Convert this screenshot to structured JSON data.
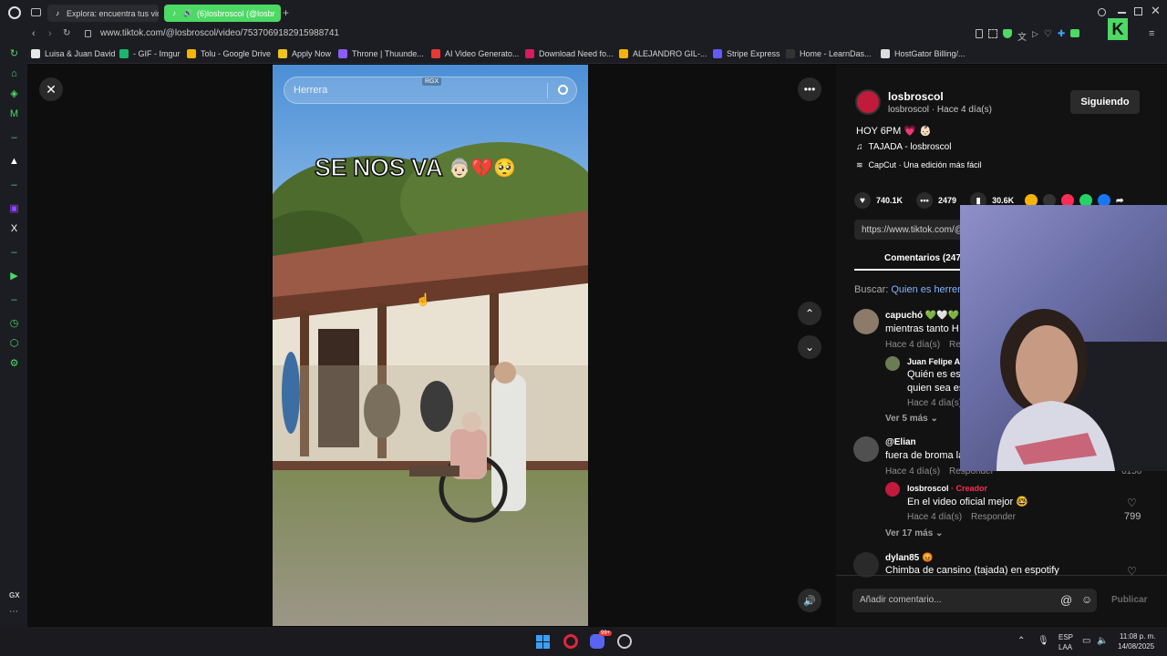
{
  "tabs": [
    {
      "label": "Explora: encuentra tus vid"
    },
    {
      "label": "(6)losbroscol (@losbr"
    }
  ],
  "address": {
    "url": "www.tiktok.com/@losbroscol/video/7537069182915988741"
  },
  "bookmarks": [
    {
      "label": "Luisa & Juan David",
      "color": "#e8e8e8"
    },
    {
      "label": "- GIF - Imgur",
      "color": "#1bb76e"
    },
    {
      "label": "Tolu - Google Drive",
      "color": "#f4b400"
    },
    {
      "label": "Apply Now",
      "color": "#f0c419"
    },
    {
      "label": "Throne | Thuunde...",
      "color": "#8b5cf6"
    },
    {
      "label": "AI Video Generato...",
      "color": "#e53935"
    },
    {
      "label": "Download Need fo...",
      "color": "#d81b60"
    },
    {
      "label": "ALEJANDRO GIL-...",
      "color": "#f4b400"
    },
    {
      "label": "Stripe Express",
      "color": "#635bff"
    },
    {
      "label": "Home - LearnDas...",
      "color": "#333333"
    },
    {
      "label": "HostGator Billing/...",
      "color": "#dddddd"
    }
  ],
  "video": {
    "search_value": "Herrera",
    "watermark": "RGX",
    "overlay_text": "SE NOS VA",
    "overlay_emoji": "👵🏻💔🥺"
  },
  "author": {
    "name": "losbroscol",
    "sub": "losbroscol · Hace 4 día(s)",
    "follow_label": "Siguiendo"
  },
  "post": {
    "caption": "HOY 6PM 💗 👶🏻",
    "music": "TAJADA - losbroscol",
    "capcut": "CapCut · Una edición más fácil"
  },
  "stats": {
    "likes": "740.1K",
    "comments": "2479",
    "saves": "30.6K"
  },
  "link": {
    "url": "https://www.tiktok.com/@"
  },
  "comments_tab": {
    "label": "Comentarios (247"
  },
  "search_suggest": {
    "prefix": "Buscar:",
    "query": "Quien es herren"
  },
  "comments": [
    {
      "name": "capuchó 💚🤍💚",
      "text": "mientras tanto H",
      "meta": "Hace 4 día(s)",
      "reply": "Re"
    },
    {
      "name": "Juan Felipe A",
      "text1": "Quién es es",
      "text2": "quien sea es",
      "meta": "Hace 4 día(s)"
    },
    {
      "more": "Ver 5 más"
    },
    {
      "name": "@Elian",
      "text": "fuera de broma la",
      "meta": "Hace 4 día(s)",
      "reply": "Responder",
      "likes": "6156"
    },
    {
      "name": "losbroscol",
      "creator": "· Creador",
      "text": "En el video oficial mejor 🤓",
      "meta": "Hace 4 día(s)",
      "reply": "Responder",
      "likes": "799"
    },
    {
      "more": "Ver 17 más"
    },
    {
      "name": "dylan85 😡",
      "text": "Chimba de cansino (tajada) en espotify"
    }
  ],
  "comment_box": {
    "placeholder": "Añadir comentario...",
    "publish": "Publicar"
  },
  "taskbar": {
    "lang1": "ESP",
    "lang2": "LAA",
    "time": "11:08 p. m.",
    "date": "14/08/2025",
    "badge": "99+"
  },
  "sidebar": {
    "gx": "GX"
  }
}
